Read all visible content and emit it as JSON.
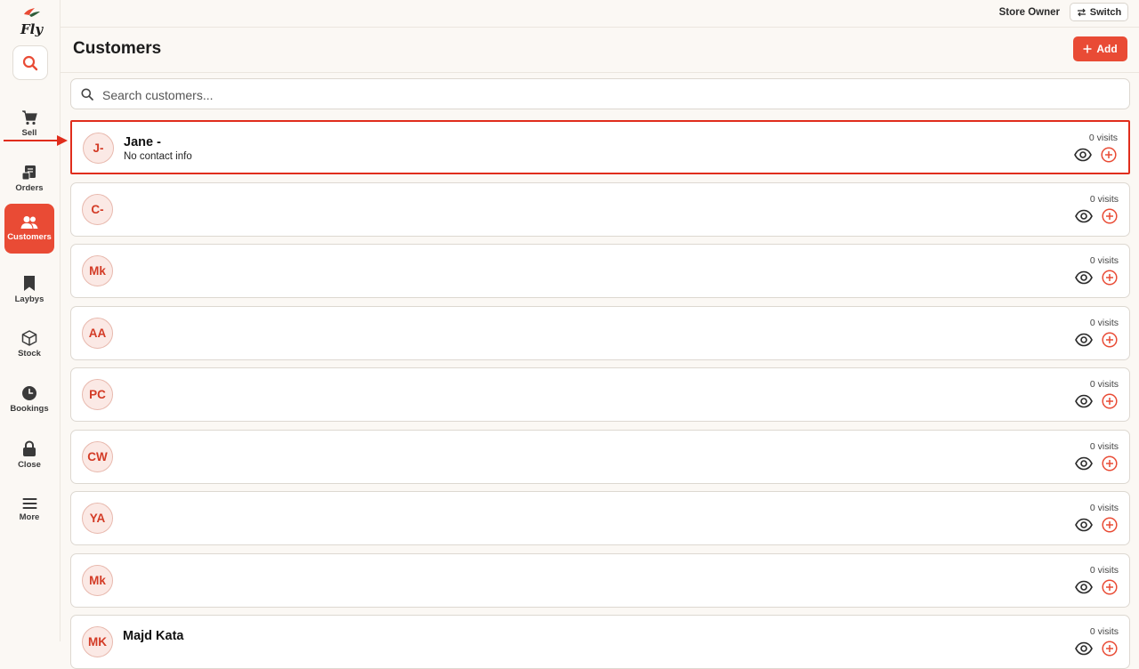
{
  "brand": {
    "logo_text": "Fly"
  },
  "sidebar": {
    "items": [
      {
        "label": "Sell",
        "icon": "cart-icon"
      },
      {
        "label": "Orders",
        "icon": "receipt-icon"
      },
      {
        "label": "Customers",
        "icon": "users-icon",
        "active": true
      },
      {
        "label": "Laybys",
        "icon": "bookmark-icon"
      },
      {
        "label": "Stock",
        "icon": "box-icon"
      },
      {
        "label": "Bookings",
        "icon": "clock-icon"
      },
      {
        "label": "Close",
        "icon": "lock-icon"
      },
      {
        "label": "More",
        "icon": "menu-icon"
      }
    ]
  },
  "topbar": {
    "role": "Store Owner",
    "switch_label": "Switch"
  },
  "header": {
    "title": "Customers",
    "add_label": "Add"
  },
  "search": {
    "placeholder": "Search customers..."
  },
  "colors": {
    "accent": "#e94b35",
    "highlight": "#e02d1c"
  },
  "customers": [
    {
      "initials": "J-",
      "name": "Jane -",
      "contact": "No contact info",
      "visits": "0 visits"
    },
    {
      "initials": "C-",
      "name": "",
      "contact": "",
      "visits": "0 visits"
    },
    {
      "initials": "Mk",
      "name": "",
      "contact": "",
      "visits": "0 visits"
    },
    {
      "initials": "AA",
      "name": "",
      "contact": "",
      "visits": "0 visits"
    },
    {
      "initials": "PC",
      "name": "",
      "contact": "",
      "visits": "0 visits"
    },
    {
      "initials": "CW",
      "name": "",
      "contact": "",
      "visits": "0 visits"
    },
    {
      "initials": "YA",
      "name": "",
      "contact": "",
      "visits": "0 visits"
    },
    {
      "initials": "Mk",
      "name": "",
      "contact": "",
      "visits": "0 visits"
    },
    {
      "initials": "MK",
      "name": "Majd Kata",
      "contact": "",
      "visits": "0 visits"
    }
  ]
}
